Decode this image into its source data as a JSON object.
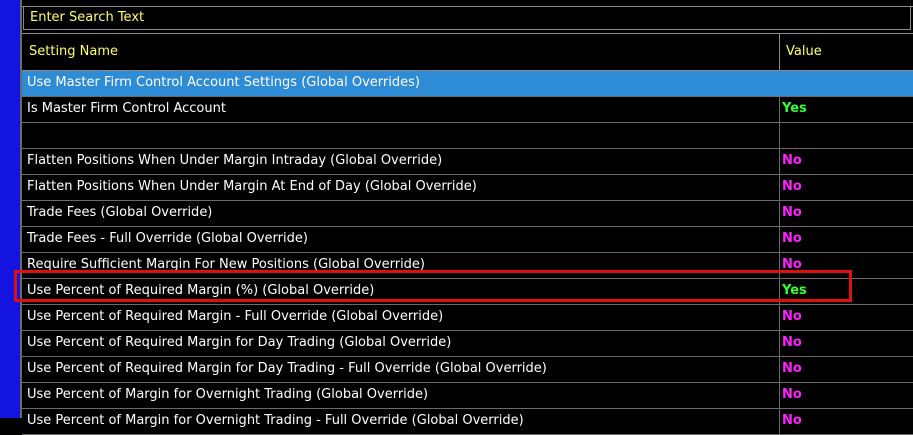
{
  "search": {
    "placeholder": "Enter Search Text"
  },
  "table": {
    "columns": {
      "name": "Setting Name",
      "value": "Value"
    },
    "rows": [
      {
        "type": "group",
        "name": "Use Master Firm Control Account Settings (Global Overrides)",
        "value": ""
      },
      {
        "type": "setting",
        "name": "Is Master Firm Control Account",
        "value": "Yes"
      },
      {
        "type": "blank",
        "name": "",
        "value": ""
      },
      {
        "type": "setting",
        "name": "Flatten Positions When Under Margin Intraday (Global Override)",
        "value": "No"
      },
      {
        "type": "setting",
        "name": "Flatten Positions When Under Margin At End of Day (Global Override)",
        "value": "No"
      },
      {
        "type": "setting",
        "name": "Trade Fees (Global Override)",
        "value": "No"
      },
      {
        "type": "setting",
        "name": "Trade Fees - Full Override (Global Override)",
        "value": "No"
      },
      {
        "type": "setting",
        "name": "Require Sufficient Margin For New Positions (Global Override)",
        "value": "No"
      },
      {
        "type": "setting",
        "name": "Use Percent of Required Margin (%) (Global Override)",
        "value": "Yes"
      },
      {
        "type": "setting",
        "name": "Use Percent of Required Margin - Full Override (Global Override)",
        "value": "No"
      },
      {
        "type": "setting",
        "name": "Use Percent of Required Margin for Day Trading (Global Override)",
        "value": "No"
      },
      {
        "type": "setting",
        "name": "Use Percent of Required Margin for Day Trading - Full Override (Global Override)",
        "value": "No"
      },
      {
        "type": "setting",
        "name": "Use Percent of Margin for Overnight Trading (Global Override)",
        "value": "No"
      },
      {
        "type": "setting",
        "name": "Use Percent of Margin for Overnight Trading - Full Override (Global Override)",
        "value": "No"
      }
    ]
  },
  "colors": {
    "yes": "#33ff33",
    "no": "#ff22ff",
    "header_text": "#ffff66",
    "group_bg": "#2e8bd6",
    "highlight_border": "#e01010"
  }
}
